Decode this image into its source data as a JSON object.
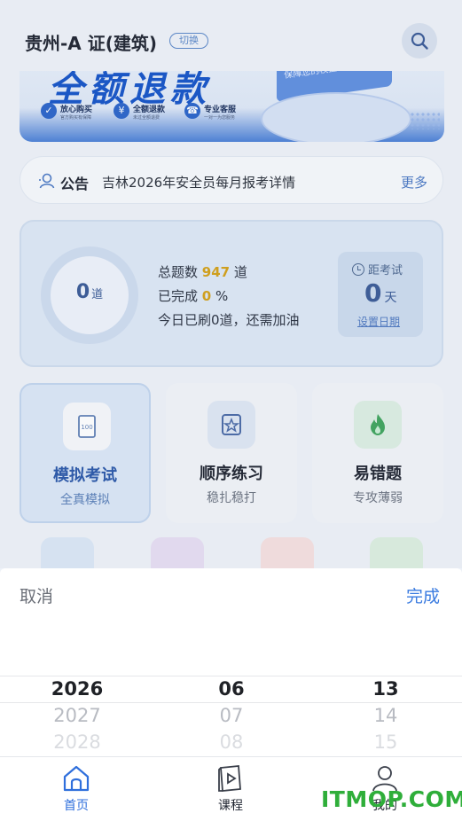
{
  "header": {
    "title": "贵州-A 证(建筑)",
    "switch_label": "切换"
  },
  "banner": {
    "title": "全额退款",
    "ribbon": "保障您的权益",
    "items": [
      {
        "icon": "shield-check-icon",
        "main": "放心购买",
        "sub": "官方购买有保障"
      },
      {
        "icon": "yen-icon",
        "main": "全额退款",
        "sub": "未过全额退费"
      },
      {
        "icon": "headset-icon",
        "main": "专业客服",
        "sub": "一对一为您服务"
      }
    ]
  },
  "notice": {
    "label": "公告",
    "text": "吉林2026年安全员每月报考详情",
    "more": "更多"
  },
  "stats": {
    "ring_value": "0",
    "ring_unit": "道",
    "total_prefix": "总题数",
    "total_value": "947",
    "total_suffix": "道",
    "done_prefix": "已完成",
    "done_value": "0",
    "done_suffix": "%",
    "today": "今日已刷0道，还需加油",
    "countdown_label": "距考试",
    "countdown_value": "0",
    "countdown_unit": "天",
    "set_date": "设置日期"
  },
  "modes": [
    {
      "title": "模拟考试",
      "sub": "全真模拟",
      "icon": "exam-paper-icon"
    },
    {
      "title": "顺序练习",
      "sub": "稳扎稳打",
      "icon": "star-book-icon"
    },
    {
      "title": "易错题",
      "sub": "专攻薄弱",
      "icon": "flame-icon"
    }
  ],
  "picker": {
    "cancel": "取消",
    "done": "完成",
    "years": [
      "2026",
      "2027",
      "2028"
    ],
    "months": [
      "06",
      "07",
      "08"
    ],
    "days": [
      "13",
      "14",
      "15"
    ]
  },
  "nav": [
    {
      "label": "首页",
      "icon": "home-icon"
    },
    {
      "label": "课程",
      "icon": "play-book-icon"
    },
    {
      "label": "我的",
      "icon": "user-icon"
    }
  ],
  "watermark": "ITMOP.COM",
  "colors": {
    "accent": "#3a7be0",
    "highlight": "#d4a017",
    "watermark": "#2fae3a"
  }
}
